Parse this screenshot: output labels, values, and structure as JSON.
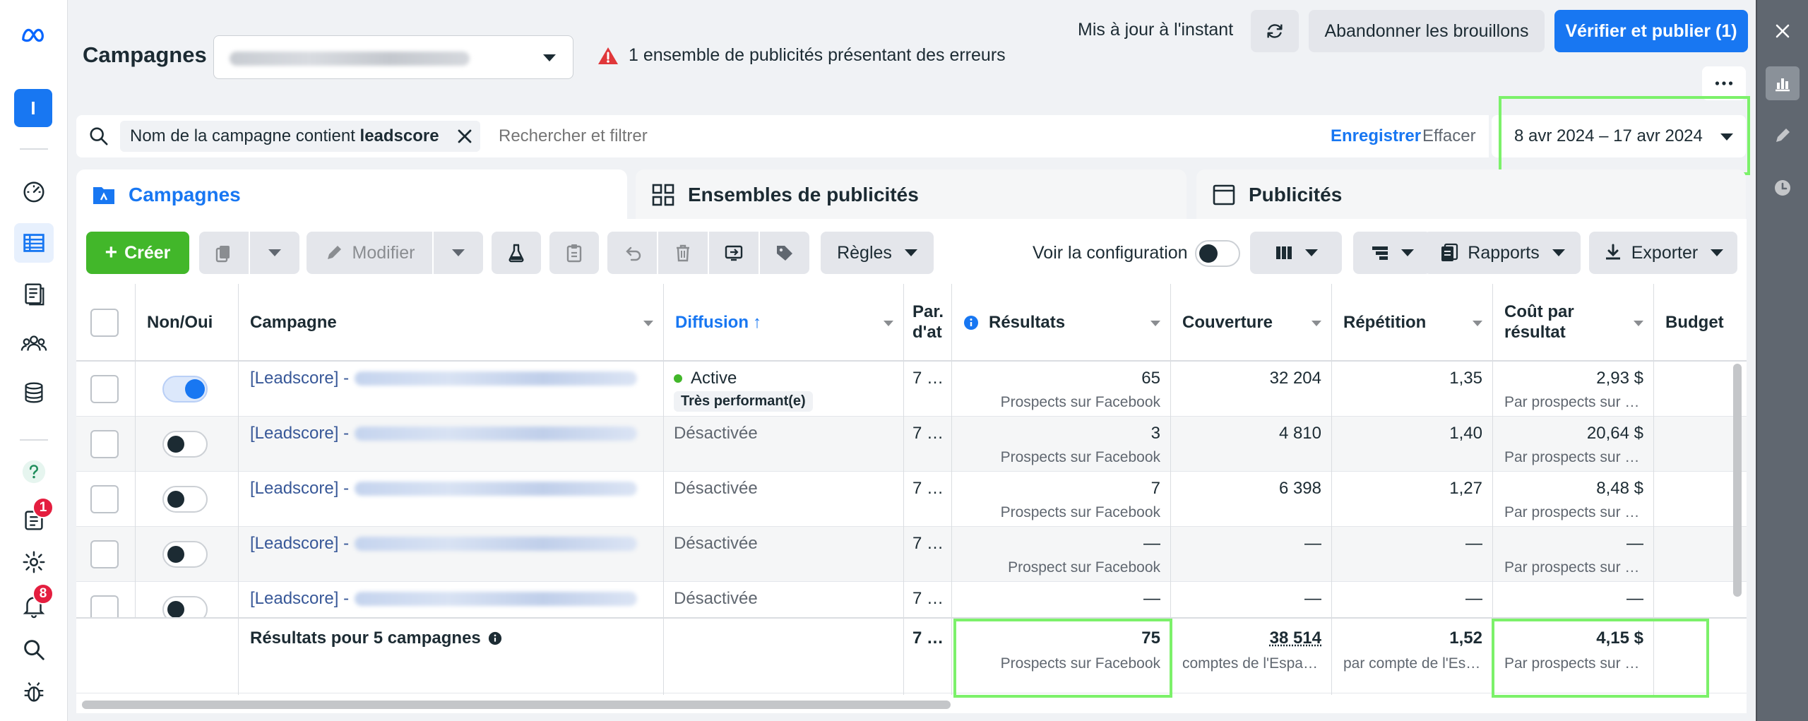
{
  "header": {
    "title": "Campagnes",
    "error_message": "1 ensemble de publicités présentant des erreurs",
    "update_status": "Mis à jour à l'instant",
    "discard_label": "Abandonner les brouillons",
    "publish_label": "Vérifier et publier (1)"
  },
  "nav": {
    "avatar_letter": "I",
    "notif_badge_1": "1",
    "notif_badge_2": "8"
  },
  "search": {
    "chip_prefix": "Nom de la campagne contient ",
    "chip_term": "leadscore",
    "placeholder": "Rechercher et filtrer",
    "save_label": "Enregistrer",
    "clear_label": "Effacer",
    "date_range": "8 avr 2024 – 17 avr 2024"
  },
  "tabs": [
    {
      "label": "Campagnes"
    },
    {
      "label": "Ensembles de publicités"
    },
    {
      "label": "Publicités"
    }
  ],
  "toolbar": {
    "create_label": "Créer",
    "edit_label": "Modifier",
    "rules_label": "Règles",
    "config_label": "Voir la configuration",
    "reports_label": "Rapports",
    "export_label": "Exporter"
  },
  "table": {
    "headers": {
      "onoff": "Non/Oui",
      "campaign": "Campagne",
      "diffusion": "Diffusion",
      "attribution": "Par. d'at",
      "results": "Résultats",
      "reach": "Couverture",
      "frequency": "Répétition",
      "cost": "Coût par résultat",
      "budget": "Budget"
    },
    "rows": [
      {
        "name": "[Leadscore] -",
        "status": "Active",
        "perf": "Très performant(e)",
        "attr": "7 …",
        "results": "65",
        "results_sub": "Prospects sur Facebook",
        "reach": "32 204",
        "freq": "1,35",
        "cost": "2,93 $",
        "cost_sub": "Par prospects sur F…",
        "on": true
      },
      {
        "name": "[Leadscore] -",
        "status": "Désactivée",
        "perf": "",
        "attr": "7 …",
        "results": "3",
        "results_sub": "Prospects sur Facebook",
        "reach": "4 810",
        "freq": "1,40",
        "cost": "20,64 $",
        "cost_sub": "Par prospects sur F…",
        "on": false
      },
      {
        "name": "[Leadscore] -",
        "status": "Désactivée",
        "perf": "",
        "attr": "7 …",
        "results": "7",
        "results_sub": "Prospects sur Facebook",
        "reach": "6 398",
        "freq": "1,27",
        "cost": "8,48 $",
        "cost_sub": "Par prospects sur F…",
        "on": false
      },
      {
        "name": "[Leadscore] -",
        "status": "Désactivée",
        "perf": "",
        "attr": "7 …",
        "results": "—",
        "results_sub": "Prospect sur Facebook",
        "reach": "—",
        "freq": "—",
        "cost": "—",
        "cost_sub": "Par prospects sur F…",
        "on": false
      },
      {
        "name": "[Leadscore] -",
        "status": "Désactivée",
        "perf": "",
        "attr": "7 …",
        "results": "—",
        "results_sub": "",
        "reach": "—",
        "freq": "—",
        "cost": "—",
        "cost_sub": "",
        "on": false
      }
    ],
    "totals": {
      "label": "Résultats pour 5 campagnes",
      "attr": "7 …",
      "results": "75",
      "results_sub": "Prospects sur Facebook",
      "reach": "38 514",
      "reach_sub": "comptes de l'Espac…",
      "freq": "1,52",
      "freq_sub": "par compte de l'Esp…",
      "cost": "4,15 $",
      "cost_sub": "Par prospects sur F…"
    }
  },
  "colors": {
    "accent": "#1877f2",
    "create": "#42b72a",
    "highlight": "#7cf16a",
    "link": "#385898"
  }
}
